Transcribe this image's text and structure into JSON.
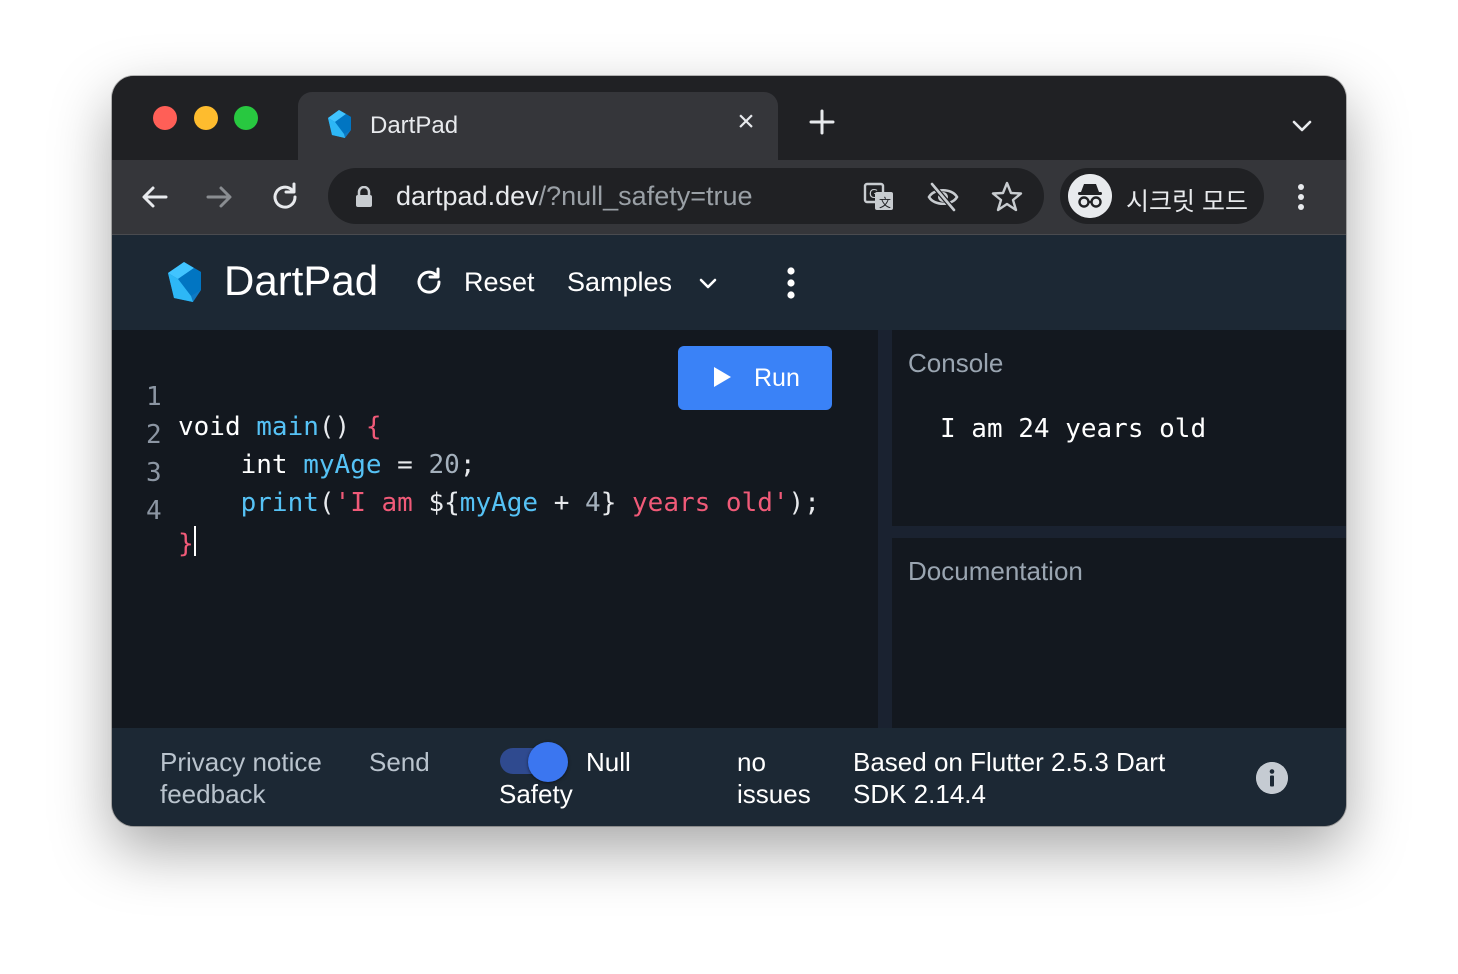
{
  "browser": {
    "tab": {
      "title": "DartPad",
      "close_glyph": "×",
      "logo_icon": "dart-logo-icon"
    },
    "url": {
      "host": "dartpad.dev",
      "path": "/?null_safety=true"
    },
    "profile_label": "시크릿 모드",
    "icons": [
      "back-icon",
      "forward-icon",
      "reload-icon",
      "lock-icon",
      "translate-icon",
      "eye-slash-icon",
      "star-icon",
      "incognito-icon",
      "more-vert-icon",
      "new-tab-icon",
      "tab-menu-icon"
    ]
  },
  "header": {
    "title": "DartPad",
    "reset_label": "Reset",
    "samples_label": "Samples"
  },
  "editor": {
    "run_label": "Run",
    "line_numbers": [
      "1",
      "2",
      "3",
      "4"
    ]
  },
  "console": {
    "title": "Console",
    "output": "I am 24 years old"
  },
  "docs": {
    "title": "Documentation"
  },
  "footer": {
    "privacy_line1": "Privacy notice",
    "privacy_line2": "feedback",
    "send_label": "Send",
    "null_safety_line1": "Null",
    "null_safety_line2": "Safety",
    "null_safety_enabled": true,
    "issues_line1": "no",
    "issues_line2": "issues",
    "version_line1": "Based on Flutter 2.5.3 Dart",
    "version_line2": "SDK 2.14.4"
  },
  "colors": {
    "accent": "#3a82f7",
    "header_bg": "#1c2834",
    "editor_bg": "#13181f",
    "keyword_blue": "#56c2f5",
    "string_red": "#f05a78"
  }
}
